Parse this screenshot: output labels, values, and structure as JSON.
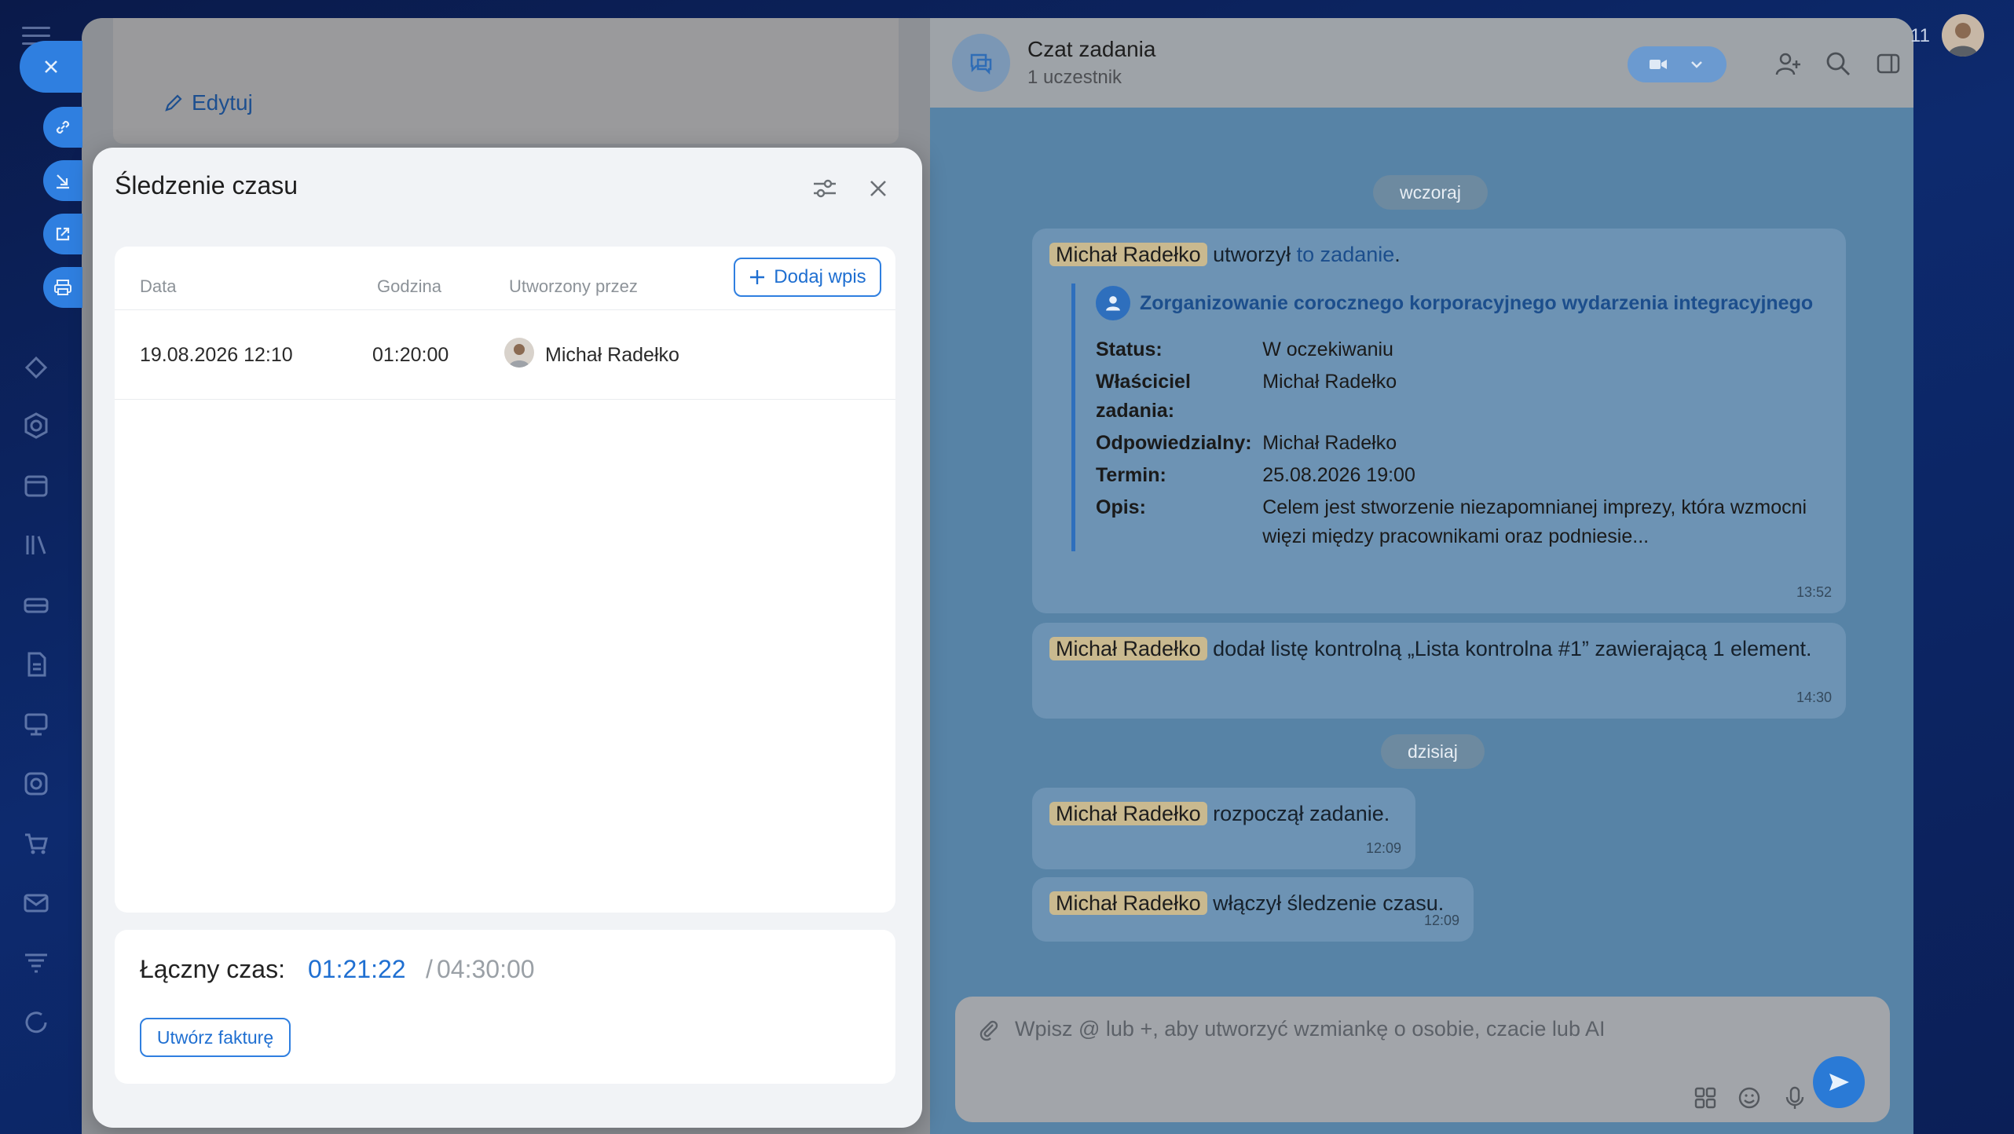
{
  "task_panel": {
    "edit_label": "Edytuj"
  },
  "chat": {
    "title": "Czat zadania",
    "subtitle": "1 uczestnik",
    "date_yesterday": "wczoraj",
    "date_today": "dzisiaj",
    "messages": [
      {
        "author": "Michał Radełko",
        "text_before_link": "utworzył",
        "link": "to zadanie",
        "text_after_link": ".",
        "time": "13:52",
        "task": {
          "title": "Zorganizowanie corocznego korporacyjnego wydarzenia integracyjnego",
          "fields": [
            {
              "label": "Status:",
              "value": "W oczekiwaniu"
            },
            {
              "label": "Właściciel zadania:",
              "value": "Michał Radełko"
            },
            {
              "label": "Odpowiedzialny:",
              "value": "Michał Radełko"
            },
            {
              "label": "Termin:",
              "value": "25.08.2026 19:00"
            },
            {
              "label": "Opis:",
              "value": "Celem jest stworzenie niezapomnianej imprezy, która wzmocni więzi między pracownikami oraz podniesie..."
            }
          ]
        }
      },
      {
        "author": "Michał Radełko",
        "text": "dodał listę kontrolną „Lista kontrolna #1” zawierającą 1 element.",
        "time": "14:30"
      },
      {
        "author": "Michał Radełko",
        "text": "rozpoczął zadanie.",
        "time": "12:09"
      },
      {
        "author": "Michał Radełko",
        "text": "włączył śledzenie czasu.",
        "time": "12:09"
      }
    ],
    "composer_placeholder": "Wpisz @ lub +, aby utworzyć wzmiankę o osobie, czacie lub AI"
  },
  "topbar": {
    "counter": "11"
  },
  "time_tracking": {
    "title": "Śledzenie czasu",
    "columns": {
      "date": "Data",
      "hours": "Godzina",
      "created_by": "Utworzony przez"
    },
    "add_entry_label": "Dodaj wpis",
    "entries": [
      {
        "date": "19.08.2026 12:10",
        "hours": "01:20:00",
        "created_by": "Michał Radełko"
      }
    ],
    "total_label": "Łączny czas:",
    "total_spent": "01:21:22",
    "total_separator": "/",
    "total_estimate": "04:30:00",
    "invoice_label": "Utwórz fakturę"
  },
  "colors": {
    "accent": "#2f7fe0",
    "link": "#1f6fd1"
  }
}
